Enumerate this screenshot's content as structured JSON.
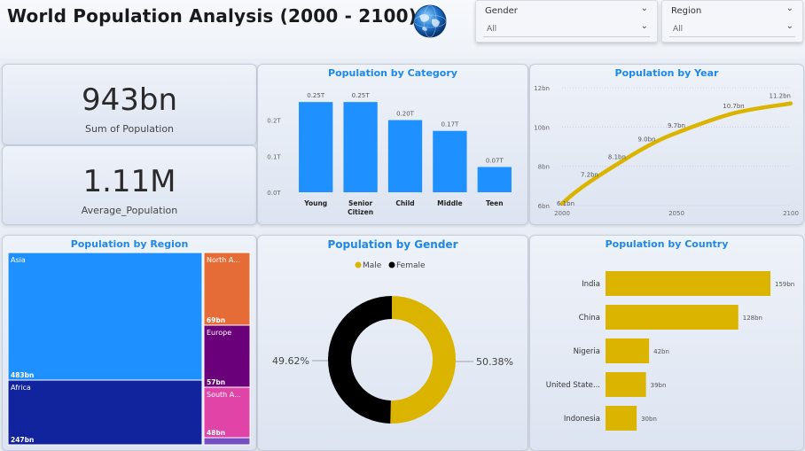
{
  "header": {
    "title": "World Population Analysis (2000 - 2100)"
  },
  "slicers": {
    "gender": {
      "label": "Gender",
      "value": "All"
    },
    "region": {
      "label": "Region",
      "value": "All"
    }
  },
  "kpis": {
    "sum": {
      "value": "943bn",
      "label": "Sum of Population"
    },
    "avg": {
      "value": "1.11M",
      "label": "Average_Population"
    }
  },
  "chart_data": [
    {
      "id": "category",
      "type": "bar",
      "title": "Population by Category",
      "categories": [
        "Young",
        "Senior Citizen",
        "Child",
        "Middle",
        "Teen"
      ],
      "category_lines": [
        [
          "Young"
        ],
        [
          "Senior",
          "Citizen"
        ],
        [
          "Child"
        ],
        [
          "Middle"
        ],
        [
          "Teen"
        ]
      ],
      "values": [
        0.25,
        0.25,
        0.2,
        0.17,
        0.07
      ],
      "data_labels": [
        "0.25T",
        "0.25T",
        "0.20T",
        "0.17T",
        "0.07T"
      ],
      "y_ticks": [
        0.0,
        0.1,
        0.2
      ],
      "y_tick_labels": [
        "0.0T",
        "0.1T",
        "0.2T"
      ],
      "ylim": [
        0,
        0.27
      ],
      "color": "#1e90ff"
    },
    {
      "id": "year",
      "type": "line",
      "title": "Population by Year",
      "x": [
        2000,
        2010,
        2020,
        2030,
        2040,
        2050,
        2060,
        2070,
        2080,
        2090,
        2100
      ],
      "values": [
        6.1,
        6.7,
        7.2,
        7.7,
        8.1,
        8.6,
        9.0,
        9.4,
        9.7,
        10.2,
        10.7,
        11.2
      ],
      "points": [
        {
          "x": 2000,
          "y": 6.1,
          "label": "6.1bn"
        },
        {
          "x": 2005,
          "y": 6.6,
          "label": ""
        },
        {
          "x": 2012,
          "y": 7.2,
          "label": "7.2bn"
        },
        {
          "x": 2024,
          "y": 8.1,
          "label": "8.1bn"
        },
        {
          "x": 2037,
          "y": 9.0,
          "label": "9.0bn"
        },
        {
          "x": 2050,
          "y": 9.7,
          "label": "9.7bn"
        },
        {
          "x": 2075,
          "y": 10.7,
          "label": "10.7bn"
        },
        {
          "x": 2100,
          "y": 11.2,
          "label": "11.2bn"
        }
      ],
      "x_ticks": [
        2000,
        2050,
        2100
      ],
      "y_ticks": [
        6,
        8,
        10,
        12
      ],
      "y_tick_labels": [
        "6bn",
        "8bn",
        "10bn",
        "12bn"
      ],
      "xlim": [
        2000,
        2100
      ],
      "ylim": [
        6,
        12
      ],
      "color": "#dbb400"
    },
    {
      "id": "region",
      "type": "heatmap",
      "title": "Population by Region",
      "items": [
        {
          "name": "Asia",
          "value": "483bn",
          "color": "#1e90ff"
        },
        {
          "name": "Africa",
          "value": "247bn",
          "color": "#12239e"
        },
        {
          "name": "North A...",
          "value": "69bn",
          "color": "#e66c37"
        },
        {
          "name": "Europe",
          "value": "57bn",
          "color": "#6b007b"
        },
        {
          "name": "South A...",
          "value": "48bn",
          "color": "#e044a7"
        }
      ]
    },
    {
      "id": "gender",
      "type": "pie",
      "title": "Population by Gender",
      "legend": [
        {
          "name": "Male",
          "color": "#dbb400"
        },
        {
          "name": "Female",
          "color": "#000000"
        }
      ],
      "values": [
        50.38,
        49.62
      ],
      "labels": [
        "50.38%",
        "49.62%"
      ]
    },
    {
      "id": "country",
      "type": "bar",
      "title": "Population by Country",
      "categories": [
        "India",
        "China",
        "Nigeria",
        "United State...",
        "Indonesia"
      ],
      "values": [
        159,
        128,
        42,
        39,
        30
      ],
      "data_labels": [
        "159bn",
        "128bn",
        "42bn",
        "39bn",
        "30bn"
      ],
      "xlim": [
        0,
        159
      ],
      "color": "#dbb400"
    }
  ]
}
